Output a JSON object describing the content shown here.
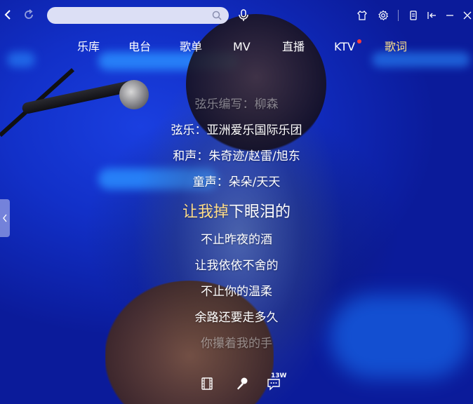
{
  "search": {
    "placeholder": ""
  },
  "tabs": [
    {
      "label": "乐库"
    },
    {
      "label": "电台"
    },
    {
      "label": "歌单"
    },
    {
      "label": "MV"
    },
    {
      "label": "直播"
    },
    {
      "label": "KTV",
      "has_dot": true
    },
    {
      "label": "歌词",
      "active": true
    }
  ],
  "lyrics": {
    "lines": [
      "弦乐编写：柳森",
      "弦乐：亚洲爱乐国际乐团",
      "和声：朱奇迹/赵雷/旭东",
      "童声：朵朵/天天"
    ],
    "current_sung": "让我掉",
    "current_rest": "下眼泪的",
    "next": [
      "不止昨夜的酒",
      "让我依依不舍的",
      "不止你的温柔",
      "余路还要走多久",
      "你攥着我的手"
    ]
  },
  "bottom": {
    "comment_count": "13W"
  },
  "colors": {
    "accent": "#ffdd8a",
    "background": "#1326b8",
    "notify_dot": "#ff3b3b"
  },
  "icons": [
    "back-icon",
    "refresh-icon",
    "search-icon",
    "voice-search-icon",
    "skin-icon",
    "gear-icon",
    "mini-mode-icon",
    "compact-mode-icon",
    "minimize-icon",
    "close-icon",
    "film-icon",
    "microphone-icon",
    "comment-icon",
    "chevron-left-icon"
  ]
}
